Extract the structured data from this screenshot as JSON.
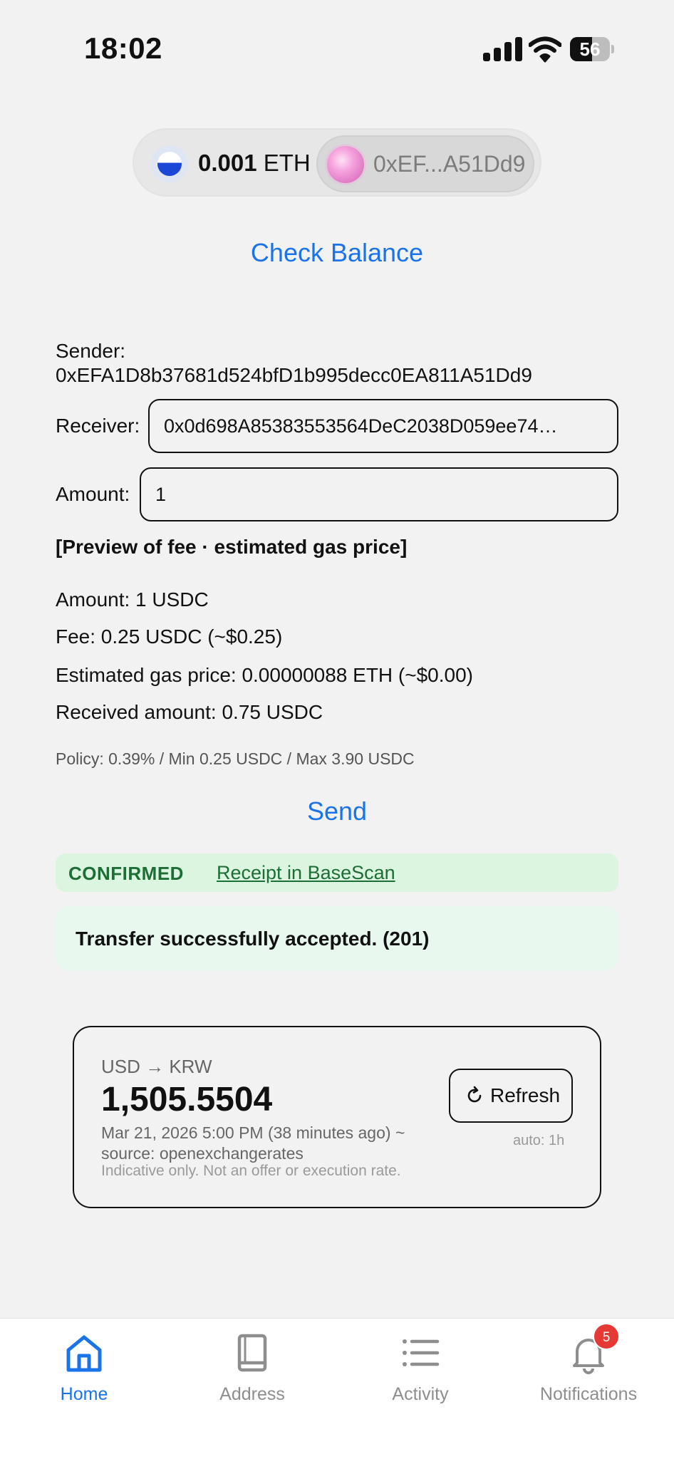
{
  "status_bar": {
    "time": "18:02",
    "battery_percent": 56,
    "battery_label": "56",
    "icons": [
      "cellular-signal-icon",
      "wifi-icon",
      "battery-icon"
    ]
  },
  "wallet": {
    "balance_value": "0.001",
    "balance_unit": "ETH",
    "account_short": "0xEF...A51Dd9",
    "token_icon": "eth-token-icon",
    "avatar_icon": "pink-orb-avatar"
  },
  "actions": {
    "check_balance": "Check Balance",
    "send": "Send"
  },
  "form": {
    "sender_label": "Sender:",
    "sender_address": "0xEFA1D8b37681d524bfD1b995decc0EA811A51Dd9",
    "receiver_label": "Receiver:",
    "receiver_value": "0x0d698A85383553564DeC2038D059ee74…",
    "amount_label": "Amount:",
    "amount_value": "1"
  },
  "preview": {
    "title": "[Preview of fee · estimated gas price]",
    "amount_line": "Amount: 1 USDC",
    "fee_line": "Fee: 0.25 USDC (~$0.25)",
    "gas_line": "Estimated gas price: 0.00000088 ETH (~$0.00)",
    "received_line": "Received amount: 0.75 USDC",
    "policy_line": "Policy: 0.39% / Min 0.25 USDC / Max 3.90 USDC"
  },
  "result": {
    "status": "CONFIRMED",
    "receipt_link": "Receipt in BaseScan",
    "message": "Transfer successfully accepted. (201)"
  },
  "fx": {
    "pair": "USD → KRW",
    "rate": "1,505.5504",
    "meta": "Mar 21, 2026 5:00 PM (38 minutes ago) ~ source: openexchangerates",
    "disclaimer": "Indicative only. Not an offer or execution rate.",
    "refresh_label": "Refresh",
    "auto_label": "auto: 1h"
  },
  "tabs": [
    {
      "label": "Home",
      "icon": "home-icon",
      "active": true
    },
    {
      "label": "Address",
      "icon": "book-icon",
      "active": false
    },
    {
      "label": "Activity",
      "icon": "list-icon",
      "active": false
    },
    {
      "label": "Notifications",
      "icon": "bell-icon",
      "active": false,
      "badge": "5"
    }
  ],
  "colors": {
    "accent": "#1a73e8",
    "success_text": "#1c6e35",
    "success_bg": "#dbf5e0",
    "badge": "#e53935"
  }
}
